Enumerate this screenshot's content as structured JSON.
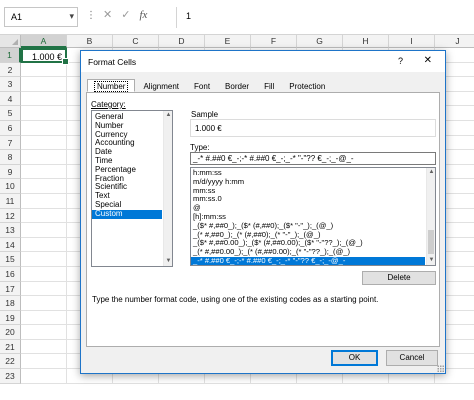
{
  "formula_bar": {
    "name_box": "A1",
    "cancel_icon": "✕",
    "enter_icon": "✓",
    "fx_label": "fx",
    "content": "1"
  },
  "sheet": {
    "columns": [
      "A",
      "B",
      "C",
      "D",
      "E",
      "F",
      "G",
      "H",
      "I",
      "J"
    ],
    "rows": [
      "1",
      "2",
      "3",
      "4",
      "5",
      "6",
      "7",
      "8",
      "9",
      "10",
      "11",
      "12",
      "13",
      "14",
      "15",
      "16",
      "17",
      "18",
      "19",
      "20",
      "21",
      "22",
      "23"
    ],
    "selected_cell": {
      "ref": "A1",
      "display": "1.000 €"
    }
  },
  "dialog": {
    "title": "Format Cells",
    "help": "?",
    "close": "✕",
    "tabs": [
      "Number",
      "Alignment",
      "Font",
      "Border",
      "Fill",
      "Protection"
    ],
    "active_tab": "Number",
    "category_label": "Category:",
    "categories": [
      "General",
      "Number",
      "Currency",
      "Accounting",
      "Date",
      "Time",
      "Percentage",
      "Fraction",
      "Scientific",
      "Text",
      "Special",
      "Custom"
    ],
    "selected_category": "Custom",
    "sample_label": "Sample",
    "sample_value": "1.000 €",
    "type_label": "Type:",
    "type_value": "_-* #.##0 €_-;-* #.##0 €_-;_-* \"-\"?? €_-;_-@_-",
    "formats": [
      "h:mm:ss",
      "m/d/yyyy h:mm",
      "mm:ss",
      "mm:ss.0",
      "@",
      "[h]:mm:ss",
      "_($* #,##0_);_($* (#,##0);_($* \"-\"_);_(@_)",
      "_(* #,##0_);_(* (#,##0);_(* \"-\"_);_(@_)",
      "_($* #,##0.00_);_($* (#,##0.00);_($* \"-\"??_);_(@_)",
      "_(* #,##0.00_);_(* (#,##0.00);_(* \"-\"??_);_(@_)",
      "_-* #.##0 €_-;-* #.##0 €_-;_-* \"-\"?? €_-;_-@_-"
    ],
    "selected_format_index": 10,
    "delete_label": "Delete",
    "hint": "Type the number format code, using one of the existing codes as a starting point.",
    "ok_label": "OK",
    "cancel_label": "Cancel"
  },
  "colors": {
    "excel_green": "#217346",
    "selection_blue": "#0078d7",
    "dialog_border": "#1e74c8"
  }
}
